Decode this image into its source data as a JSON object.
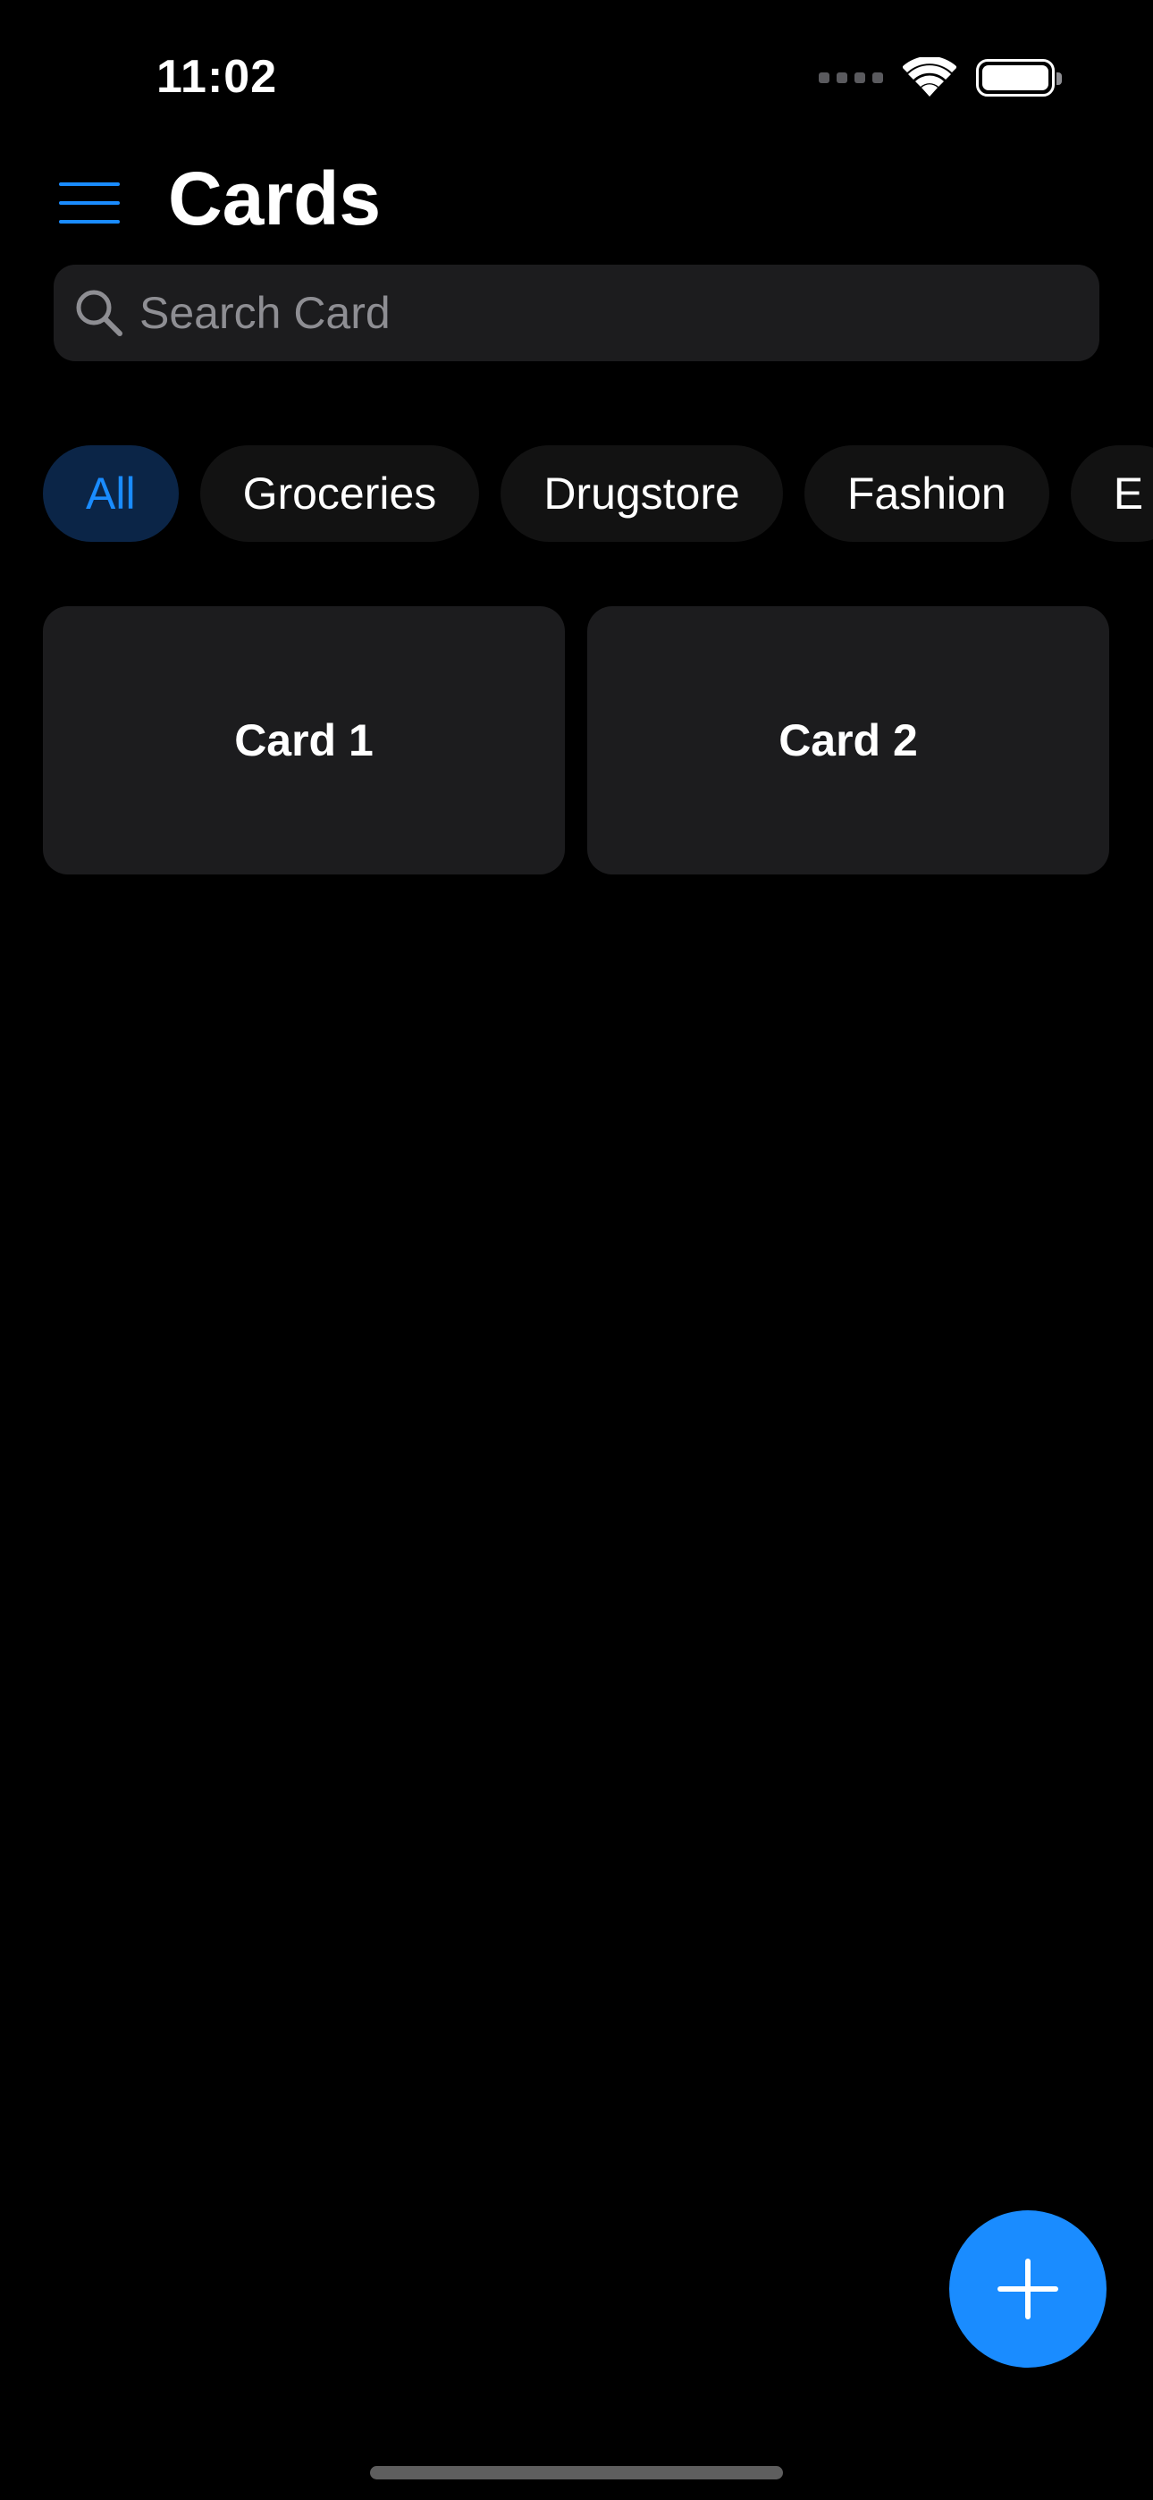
{
  "status_bar": {
    "time": "11:02"
  },
  "header": {
    "title": "Cards",
    "menu_icon": "hamburger-menu-icon"
  },
  "search": {
    "placeholder": "Search Card",
    "value": "",
    "icon": "search-icon"
  },
  "categories": {
    "selected": "All",
    "items": [
      {
        "label": "All"
      },
      {
        "label": "Groceries"
      },
      {
        "label": "Drugstore"
      },
      {
        "label": "Fashion"
      },
      {
        "label": "E"
      }
    ]
  },
  "cards": [
    {
      "label": "Card 1"
    },
    {
      "label": "Card 2"
    }
  ],
  "fab": {
    "icon": "plus-icon"
  },
  "colors": {
    "background": "#000000",
    "accent": "#1a8cff",
    "surface": "#1c1c1e",
    "chip_background": "#121212",
    "chip_active_background": "#0b2547",
    "placeholder": "#8e8e93"
  }
}
